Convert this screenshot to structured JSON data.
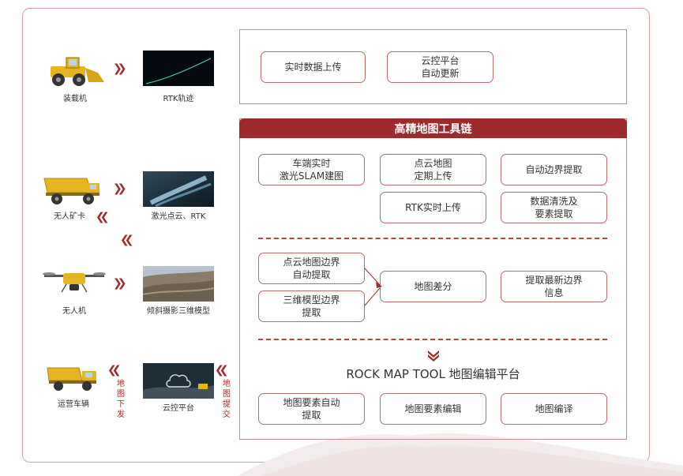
{
  "sources": {
    "loader": {
      "label": "装载机",
      "thumb_label": "RTK轨迹"
    },
    "truck": {
      "label": "无人矿卡",
      "thumb_label": "激光点云、RTK"
    },
    "drone": {
      "label": "无人机",
      "thumb_label": "倾斜摄影三维模型"
    },
    "dump_truck": {
      "label": "运营车辆",
      "thumb_label": "云控平台"
    }
  },
  "flow_labels": {
    "download": "地图\n下发",
    "submit": "地图\n提交"
  },
  "top_panel": {
    "realtime_upload": "实时数据上传",
    "cloud_update": "云控平台\n自动更新"
  },
  "toolchain": {
    "title": "高精地图工具链",
    "row1": {
      "vehicle_slam": "车端实时\n激光SLAM建图",
      "pointcloud_periodic": "点云地图\n定期上传",
      "auto_boundary": "自动边界提取"
    },
    "row2": {
      "rtk_upload": "RTK实时上传",
      "data_cleaning": "数据清洗及\n要素提取"
    },
    "diff": {
      "pointcloud_boundary": "点云地图边界\n自动提取",
      "model_boundary": "三维模型边界\n提取",
      "map_diff": "地图差分",
      "latest_boundary": "提取最新边界\n信息"
    },
    "platform_title": "ROCK MAP TOOL 地图编辑平台",
    "platform": {
      "auto_extract": "地图要素自动\n提取",
      "element_edit": "地图要素编辑",
      "map_compile": "地图编译"
    }
  },
  "colors": {
    "accent": "#9e2a2b",
    "border": "#b86b6b",
    "vehicle_yellow": "#e6b422"
  }
}
